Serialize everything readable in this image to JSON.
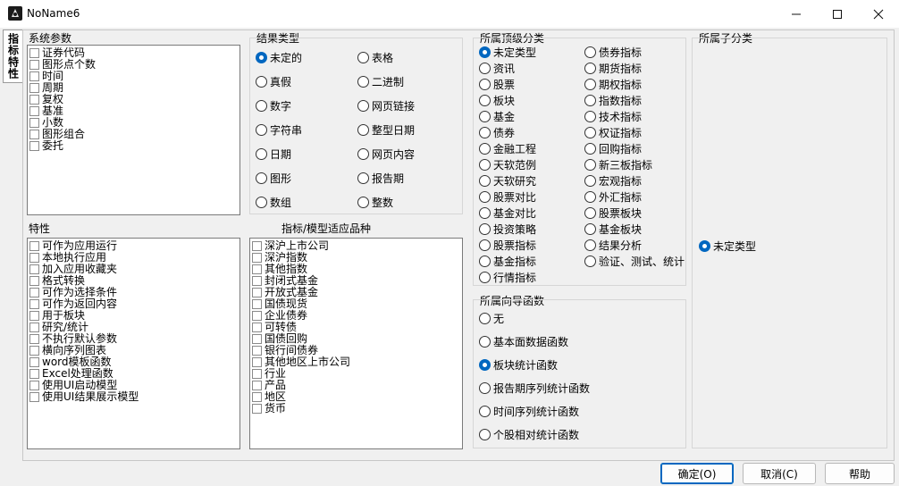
{
  "window": {
    "title": "NoName6"
  },
  "tab": {
    "label": "指标特性"
  },
  "sys_params": {
    "label": "系统参数",
    "items": [
      "证券代码",
      "图形点个数",
      "时间",
      "周期",
      "复权",
      "基准",
      "小数",
      "图形组合",
      "委托"
    ]
  },
  "result_type": {
    "label": "结果类型",
    "left": [
      "未定的",
      "真假",
      "数字",
      "字符串",
      "日期",
      "图形",
      "数组"
    ],
    "right": [
      "表格",
      "二进制",
      "网页链接",
      "整型日期",
      "网页内容",
      "报告期",
      "整数"
    ],
    "selected": "未定的"
  },
  "top_category": {
    "label": "所属顶级分类",
    "left": [
      "未定类型",
      "资讯",
      "股票",
      "板块",
      "基金",
      "债券",
      "金融工程",
      "天软范例",
      "天软研究",
      "股票对比",
      "基金对比",
      "投资策略",
      "股票指标",
      "基金指标",
      "行情指标"
    ],
    "right": [
      "债券指标",
      "期货指标",
      "期权指标",
      "指数指标",
      "技术指标",
      "权证指标",
      "回购指标",
      "新三板指标",
      "宏观指标",
      "外汇指标",
      "股票板块",
      "基金板块",
      "结果分析",
      "验证、测试、统计"
    ],
    "selected": "未定类型"
  },
  "sub_category": {
    "label": "所属子分类",
    "option": "未定类型"
  },
  "features": {
    "label": "特性",
    "items": [
      "可作为应用运行",
      "本地执行应用",
      "加入应用收藏夹",
      "格式转换",
      "可作为选择条件",
      "可作为返回内容",
      "用于板块",
      "研究/统计",
      "不执行默认参数",
      "横向序列图表",
      "word模板函数",
      "Excel处理函数",
      "使用UI启动模型",
      "使用UI结果展示模型"
    ]
  },
  "applicable": {
    "label": "指标/模型适应品种",
    "items": [
      "深沪上市公司",
      "深沪指数",
      "其他指数",
      "封闭式基金",
      "开放式基金",
      "国债现货",
      "企业债券",
      "可转债",
      "国债回购",
      "银行间债券",
      "其他地区上市公司",
      "行业",
      "产品",
      "地区",
      "货币"
    ]
  },
  "wizard_func": {
    "label": "所属向导函数",
    "items": [
      "无",
      "基本面数据函数",
      "板块统计函数",
      "报告期序列统计函数",
      "时间序列统计函数",
      "个股相对统计函数"
    ],
    "selected": "板块统计函数"
  },
  "buttons": {
    "ok": "确定(O)",
    "cancel": "取消(C)",
    "help": "帮助"
  }
}
